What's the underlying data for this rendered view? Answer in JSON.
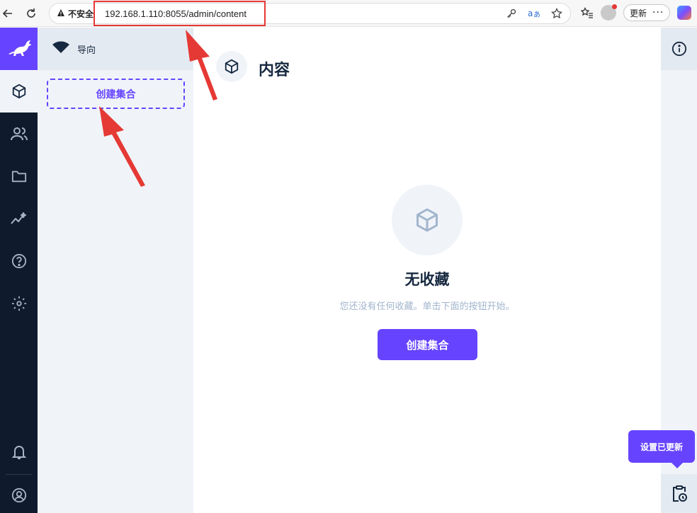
{
  "browser": {
    "security_label": "不安全",
    "url": "192.168.1.110:8055/admin/content",
    "update_label": "更新",
    "more_label": "···"
  },
  "module_bar": {
    "items": [
      "content",
      "user-directory",
      "files",
      "insights",
      "help",
      "settings"
    ],
    "footer_items": [
      "notifications",
      "user"
    ]
  },
  "nav": {
    "header_title": "导向",
    "create_collection_label": "创建集合"
  },
  "main": {
    "page_title": "内容",
    "empty_title": "无收藏",
    "empty_description": "您还没有任何收藏。单击下面的按钮开始。",
    "create_collection_label": "创建集合"
  },
  "toast": {
    "message": "设置已更新"
  },
  "colors": {
    "accent": "#6644ff",
    "module_bar_bg": "#0f1b2d",
    "nav_bg": "#f0f4f9",
    "annotation_red": "#e53935"
  }
}
